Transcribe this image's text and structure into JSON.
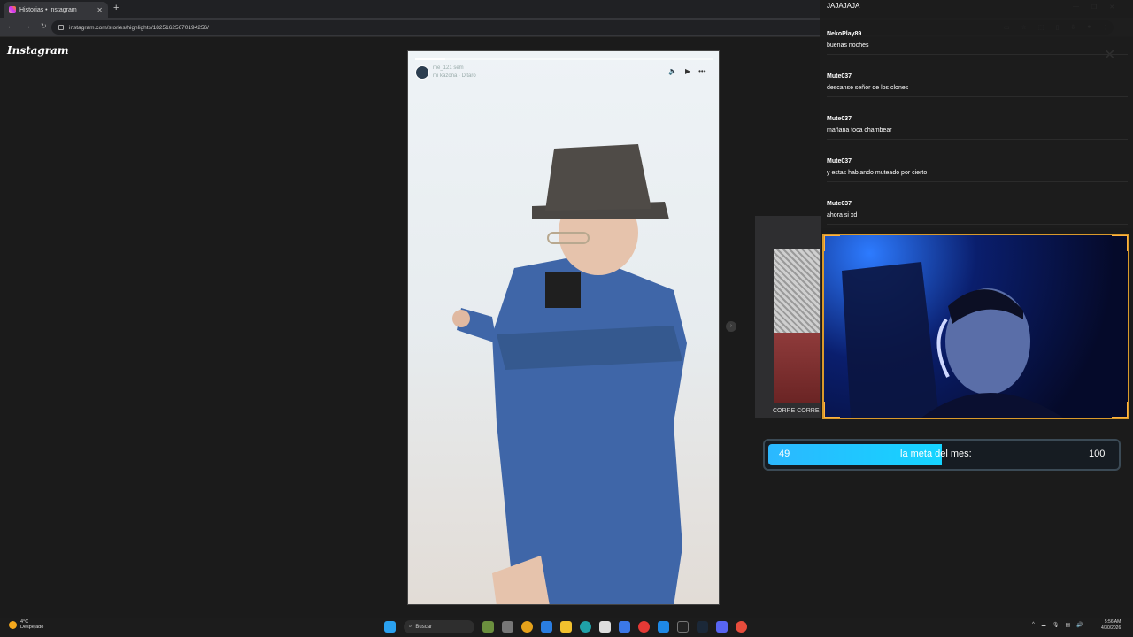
{
  "browser": {
    "tab_title": "Historias • Instagram",
    "url": "instagram.com/stories/highlights/18251625670194256/"
  },
  "instagram": {
    "logo": "Instagram",
    "story": {
      "username": "me_121 sem",
      "subtitle": "mi kazona · Ditaro",
      "progress": 0.1
    }
  },
  "chat": {
    "top_message": "JAJAJAJA",
    "messages": [
      {
        "user": "NekoPlay89",
        "text": "buenas noches"
      },
      {
        "user": "Mute037",
        "text": "descanse señor de los clones"
      },
      {
        "user": "Mute037",
        "text": "mañana toca chambear"
      },
      {
        "user": "Mute037",
        "text": "y estas hablando muteado por cierto"
      },
      {
        "user": "Mute037",
        "text": "ahora si xd"
      }
    ]
  },
  "overlay": {
    "side_caption": "CORRE CORRE",
    "goal": {
      "label": "la meta del mes:",
      "current": "49",
      "target": "100",
      "fill_fraction": 0.5
    }
  },
  "taskbar": {
    "weather_temp": "4°C",
    "weather_desc": "Despejado",
    "search_label": "Buscar",
    "time": "5:56 AM",
    "date": "4/30/2026"
  },
  "colors": {
    "accent": "#15d4ff",
    "frame": "#ffb23f"
  }
}
